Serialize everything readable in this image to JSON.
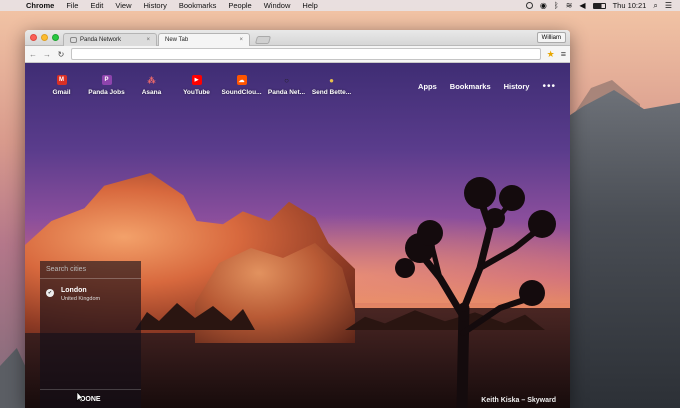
{
  "menubar": {
    "app": "Chrome",
    "items": [
      "File",
      "Edit",
      "View",
      "History",
      "Bookmarks",
      "People",
      "Window",
      "Help"
    ],
    "clock": "Thu 10:21"
  },
  "browser": {
    "tabs": [
      {
        "title": "Panda Network",
        "close": "×"
      },
      {
        "title": "New Tab",
        "close": "×"
      }
    ],
    "profile": "William",
    "omnibox": {
      "value": ""
    }
  },
  "newtab": {
    "shortcuts": [
      {
        "label": "Gmail",
        "icon": "gmail-icon",
        "glyph": "M",
        "color": "#d93025"
      },
      {
        "label": "Panda Jobs",
        "icon": "panda-jobs-icon",
        "glyph": "P",
        "color": "#8e44ad"
      },
      {
        "label": "Asana",
        "icon": "asana-icon",
        "glyph": "⁂",
        "color": "#f06a6a"
      },
      {
        "label": "YouTube",
        "icon": "youtube-icon",
        "glyph": "▶",
        "color": "#ff0000"
      },
      {
        "label": "SoundClou...",
        "icon": "soundcloud-icon",
        "glyph": "☁",
        "color": "#ff5500"
      },
      {
        "label": "Panda Net...",
        "icon": "panda-network-icon",
        "glyph": "○",
        "color": "#444444"
      },
      {
        "label": "Send Bette...",
        "icon": "send-better-icon",
        "glyph": "●",
        "color": "#e8c04a"
      }
    ],
    "top_links": [
      "Apps",
      "Bookmarks",
      "History"
    ],
    "more": "•••",
    "city_panel": {
      "search_placeholder": "Search cities",
      "cities": [
        {
          "name": "London",
          "country": "United Kingdom"
        }
      ],
      "done_label": "DONE"
    },
    "photo_credit": "Keith Kiska – Skyward"
  }
}
